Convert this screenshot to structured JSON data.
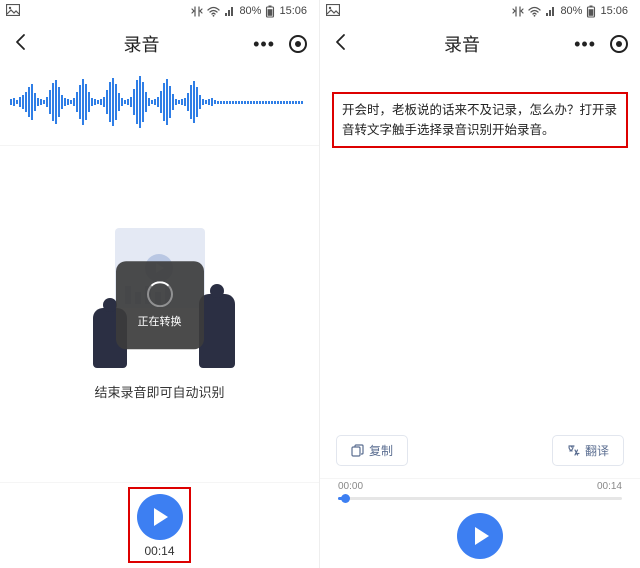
{
  "status": {
    "battery_pct": "80%",
    "time": "15:06"
  },
  "nav": {
    "title": "录音"
  },
  "left": {
    "caption": "结束录音即可自动识别",
    "toast": "正在转换",
    "timer": "00:14"
  },
  "right": {
    "transcript": "开会时，老板说的话来不及记录，怎么办？打开录音转文字触手选择录音识别开始录音。",
    "copy_label": "复制",
    "translate_label": "翻译",
    "slider_start": "00:00",
    "slider_end": "00:14"
  }
}
